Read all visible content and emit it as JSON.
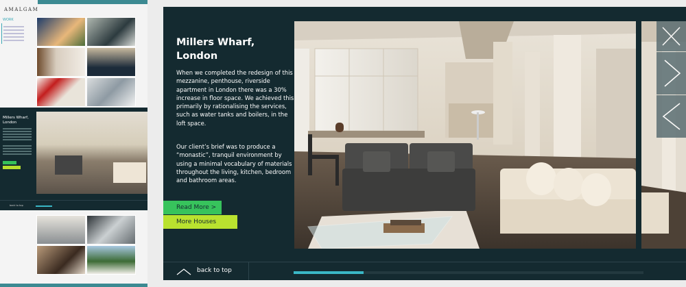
{
  "mini_page": {
    "logo": "AMALGAM",
    "nav_selected": "WORK",
    "detail_title_line1": "Millers Wharf,",
    "detail_title_line2": "London",
    "back_to_top": "back to top"
  },
  "project": {
    "title_line1": "Millers Wharf,",
    "title_line2": "London",
    "paragraph1": "When we completed the redesign of this mezzanine, penthouse, riverside apartment in London there was a 30% increase in floor space. We achieved this primarily by rationalising the services, such as water tanks and boilers, in the loft space.",
    "paragraph2": "Our client’s brief was to produce a “monastic”, tranquil environment by using a minimal vocabulary of materials throughout the living, kitchen, bedroom and bathroom areas."
  },
  "buttons": {
    "read_more": "Read More >",
    "more_houses": "More Houses"
  },
  "controls": {
    "close_icon": "close-icon",
    "next_icon": "chevron-right-icon",
    "prev_icon": "chevron-left-icon"
  },
  "footer": {
    "back_to_top": "back to top",
    "slide_progress": 0.2
  },
  "colors": {
    "panel": "#142a30",
    "accent_teal": "#3ab7c6",
    "read_more_green": "#37c35c",
    "more_houses_lime": "#b9e22f"
  }
}
